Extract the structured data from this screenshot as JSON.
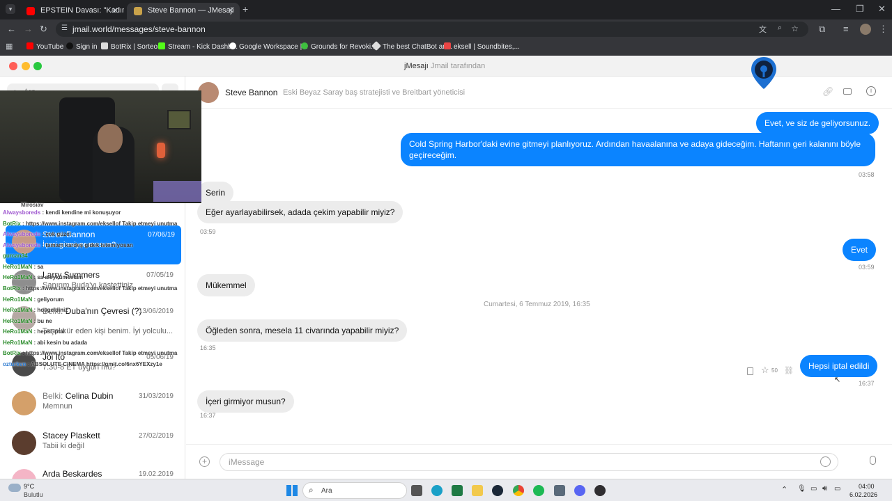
{
  "browser": {
    "tabs": [
      {
        "title": "EPSTEIN Davası: \"Kadın ve Çocu",
        "active": false
      },
      {
        "title": "Steve Bannon — JMesaji",
        "active": true
      }
    ],
    "new_tab": "+",
    "url": "jmail.world/messages/steve-bannon",
    "bookmarks": [
      "YouTube",
      "Sign in",
      "BotRix | Sorteos",
      "Stream - Kick Dashb...",
      "Google Workspace |...",
      "Grounds for Revoki...",
      "The best ChatBot an...",
      "eksell | Soundbites,..."
    ]
  },
  "app": {
    "title": "jMesajı",
    "subtitle": "Jmail tarafından"
  },
  "sidebar": {
    "search_placeholder": "Ara",
    "conversations": [
      {
        "prefix": "",
        "name": "Steve Bannon",
        "date": "07/06/19",
        "preview": "İçeri girmiyor musun?",
        "selected": true
      },
      {
        "prefix": "",
        "name": "Larry Summers",
        "date": "07/05/19",
        "preview": "Sanırım Buda'yı kastettiniz",
        "selected": false
      },
      {
        "prefix": "Belki: ",
        "name": "Duba'nın Çevresi (?)",
        "date": "13/06/2019",
        "preview": "Teşekkür eden kişi benim. İyi yolculu...",
        "selected": false
      },
      {
        "prefix": "",
        "name": "Joi Ito",
        "date": "05/06/19",
        "preview": "7:30-8 ET uygun mu?",
        "selected": false
      },
      {
        "prefix": "Belki: ",
        "name": "Celina Dubin",
        "date": "31/03/2019",
        "preview": "Memnun",
        "selected": false
      },
      {
        "prefix": "",
        "name": "Stacey Plaskett",
        "date": "27/02/2019",
        "preview": "Tabii ki değil",
        "selected": false
      },
      {
        "prefix": "",
        "name": "Arda Beskardes",
        "date": "19.02.2019",
        "preview": "",
        "selected": false
      }
    ]
  },
  "chat": {
    "contact_name": "Steve Bannon",
    "contact_desc": "Eski Beyaz Saray baş stratejisti ve Breitbart yöneticisi",
    "messages": [
      {
        "dir": "out",
        "text": "Evet, ve siz de geliyorsunuz."
      },
      {
        "dir": "out",
        "text": "Cold Spring Harbor'daki evine gitmeyi planlıyoruz. Ardından havaalanına ve adaya gideceğim. Haftanın geri kalanını böyle geçireceğim."
      },
      {
        "dir": "time",
        "text": "03:58"
      },
      {
        "dir": "in",
        "text": "Serin"
      },
      {
        "dir": "in",
        "text": "Eğer ayarlayabilirsek, adada çekim yapabilir miyiz?"
      },
      {
        "dir": "time",
        "text": "03:59"
      },
      {
        "dir": "out",
        "text": "Evet"
      },
      {
        "dir": "time",
        "text": "03:59"
      },
      {
        "dir": "in",
        "text": "Mükemmel"
      },
      {
        "dir": "date",
        "text": "Cumartesi, 6 Temmuz 2019, 16:35"
      },
      {
        "dir": "in",
        "text": "Öğleden sonra, mesela 11 civarında yapabilir miyiz?"
      },
      {
        "dir": "time",
        "text": "16:35"
      },
      {
        "dir": "out",
        "text": "Hepsi iptal edildi"
      },
      {
        "dir": "time",
        "text": "16:37"
      },
      {
        "dir": "in",
        "text": "İçeri girmiyor musun?"
      },
      {
        "dir": "time",
        "text": "16:37"
      }
    ],
    "star_count": "50",
    "input_placeholder": "iMessage"
  },
  "stream_chat": [
    {
      "user": "Mirosiav",
      "msg": "",
      "color": "#555555"
    },
    {
      "user": "Alwaysboreds",
      "msg": "kendi kendine mi konuşuyor",
      "color": "#a05ad0"
    },
    {
      "user": "BotRix",
      "msg": "https://www.instagram.com/eksellof Takip etmeyi unutma",
      "color": "#2c8c2c"
    },
    {
      "user": "Alwaysboreds",
      "msg": "çok güzel",
      "color": "#a05ad0"
    },
    {
      "user": "Alwaysboreds",
      "msg": "tamam kardeş gidek istemiyosan",
      "color": "#a05ad0"
    },
    {
      "user": "gurcan34",
      "msg": "",
      "color": "#2c8c2c"
    },
    {
      "user": "HeRo1MaN",
      "msg": "sa",
      "color": "#2c8c2c"
    },
    {
      "user": "HeRo1MaN",
      "msg": "sa aleykümselam",
      "color": "#2c8c2c"
    },
    {
      "user": "BotRix",
      "msg": "https://www.instagram.com/eksellof Takip etmeyi unutma",
      "color": "#2c8c2c"
    },
    {
      "user": "HeRo1MaN",
      "msg": "geliyorum",
      "color": "#2c8c2c"
    },
    {
      "user": "HeRo1MaN",
      "msg": "hoşgeldiniz",
      "color": "#2c8c2c"
    },
    {
      "user": "HeRo1MaN",
      "msg": "bu ne",
      "color": "#2c8c2c"
    },
    {
      "user": "HeRo1MaN",
      "msg": "hepsi iptal",
      "color": "#2c8c2c"
    },
    {
      "user": "HeRo1MaN",
      "msg": "abi kesin bu adada",
      "color": "#2c8c2c"
    },
    {
      "user": "BotRix",
      "msg": "https://www.instagram.com/eksellof Takip etmeyi unutma",
      "color": "#2c8c2c"
    },
    {
      "user": "ozturkvn",
      "msg": "ABSOLUTE CINEMA https://gmit.co/6nx6YEXzy1e",
      "color": "#2c7ad0"
    }
  ],
  "taskbar": {
    "weather_temp": "9°C",
    "weather_desc": "Bulutlu",
    "search_label": "Ara",
    "time": "04:00",
    "date": "6.02.2026"
  },
  "colors": {
    "accent": "#0b84ff",
    "incoming": "#ececec",
    "chrome_dark": "#202124"
  }
}
